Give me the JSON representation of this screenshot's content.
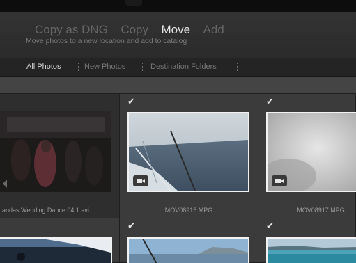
{
  "import_dialog": {
    "modes": [
      {
        "label": "Copy as DNG",
        "active": false
      },
      {
        "label": "Copy",
        "active": false
      },
      {
        "label": "Move",
        "active": true
      },
      {
        "label": "Add",
        "active": false
      }
    ],
    "subtitle": "Move photos to a new location and add to catalog",
    "tabs": [
      {
        "label": "All Photos",
        "active": true
      },
      {
        "label": "New Photos",
        "active": false
      },
      {
        "label": "Destination Folders",
        "active": false
      }
    ]
  },
  "grid": {
    "row1": [
      {
        "filename": "andas Wedding Dance 04 1.avi",
        "checked": false,
        "video": true
      },
      {
        "filename": "MOV08915.MPG",
        "checked": true,
        "video": true
      },
      {
        "filename": "MOV08917.MPG",
        "checked": true,
        "video": true
      }
    ],
    "row2": [
      {
        "checked": false
      },
      {
        "checked": true
      },
      {
        "checked": true
      }
    ],
    "check_glyph": "✔"
  },
  "colors": {
    "active_text": "#e6e6e6",
    "inactive_text": "#666666",
    "selection_border": "#f2f2f2"
  }
}
